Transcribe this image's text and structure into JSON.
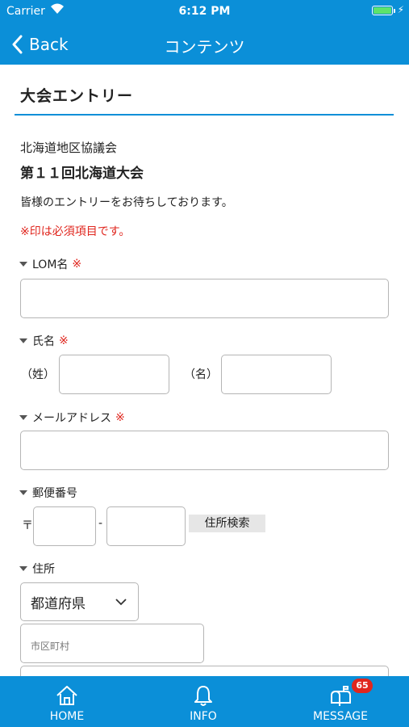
{
  "status_bar": {
    "carrier": "Carrier",
    "time": "6:12 PM"
  },
  "nav": {
    "back_label": "Back",
    "title": "コンテンツ"
  },
  "page": {
    "title": "大会エントリー",
    "organization": "北海道地区協議会",
    "event": "第１１回北海道大会",
    "notice": "皆様のエントリーをお待ちしております。",
    "required_note": "※印は必須項目です。",
    "required_mark": "※"
  },
  "form": {
    "lom": {
      "label": "LOM名",
      "value": ""
    },
    "name": {
      "label": "氏名",
      "last_label": "（姓）",
      "first_label": "（名）"
    },
    "email": {
      "label": "メールアドレス",
      "value": ""
    },
    "postal": {
      "label": "郵便番号",
      "prefix": "〒",
      "separator": "-",
      "search_button": "住所検索"
    },
    "address": {
      "label": "住所",
      "prefecture_selected": "都道府県",
      "city_placeholder": "市区町村"
    }
  },
  "tabbar": {
    "tabs": [
      {
        "label": "HOME",
        "icon": "home-icon"
      },
      {
        "label": "INFO",
        "icon": "bell-icon"
      },
      {
        "label": "MESSAGE",
        "icon": "mailbox-icon",
        "badge": "65"
      }
    ]
  },
  "colors": {
    "accent": "#0b8fd8",
    "required": "#e0261e",
    "badge": "#e0261e",
    "battery": "#5de36b"
  }
}
